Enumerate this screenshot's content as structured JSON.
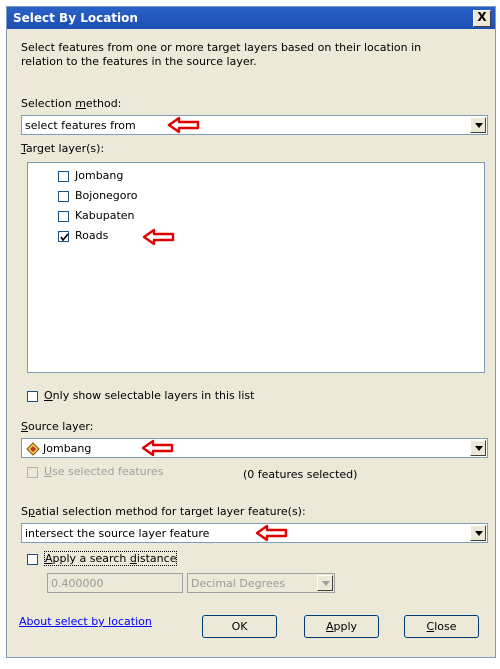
{
  "window": {
    "title": "Select By Location",
    "close_glyph": "X"
  },
  "description": {
    "line1": "Select features from one or more target layers based on their location in",
    "line2": "relation to the features in the source layer."
  },
  "selection_method": {
    "label_pre": "Selection ",
    "label_u": "m",
    "label_post": "ethod:",
    "value": "select features from"
  },
  "target_layers": {
    "label_u": "T",
    "label_post": "arget layer(s):",
    "items": [
      {
        "label": "Jombang",
        "checked": false
      },
      {
        "label": "Bojonegoro",
        "checked": false
      },
      {
        "label": "Kabupaten",
        "checked": false
      },
      {
        "label": "Roads",
        "checked": true
      }
    ]
  },
  "only_selectable": {
    "label_u": "O",
    "label_post": "nly show selectable layers in this list",
    "checked": false
  },
  "source_layer": {
    "label_u": "S",
    "label_post": "ource layer:",
    "value": "Jombang",
    "icon": "polygon-layer-icon"
  },
  "use_selected": {
    "label_u": "U",
    "label_post": "se selected features",
    "checked": false,
    "enabled": false
  },
  "features_selected": "(0 features selected)",
  "spatial_method": {
    "label_pre": "S",
    "label_u": "p",
    "label_post": "atial selection method for target layer feature(s):",
    "value": "intersect the source layer feature"
  },
  "search_distance": {
    "label_u": "A",
    "label_post": "pply a search ",
    "label_u2": "d",
    "label_post2": "istance",
    "checked": false,
    "value": "0.400000",
    "unit": "Decimal Degrees"
  },
  "footer": {
    "help_link": "About select by location",
    "ok_label": "OK",
    "apply_u": "A",
    "apply_post": "pply",
    "close_u": "C",
    "close_post": "lose"
  },
  "colors": {
    "titlebar": "#1c4eb3",
    "dialog_bg": "#ece9d8",
    "annotation_arrow": "#e00000",
    "link": "#0000ff"
  }
}
